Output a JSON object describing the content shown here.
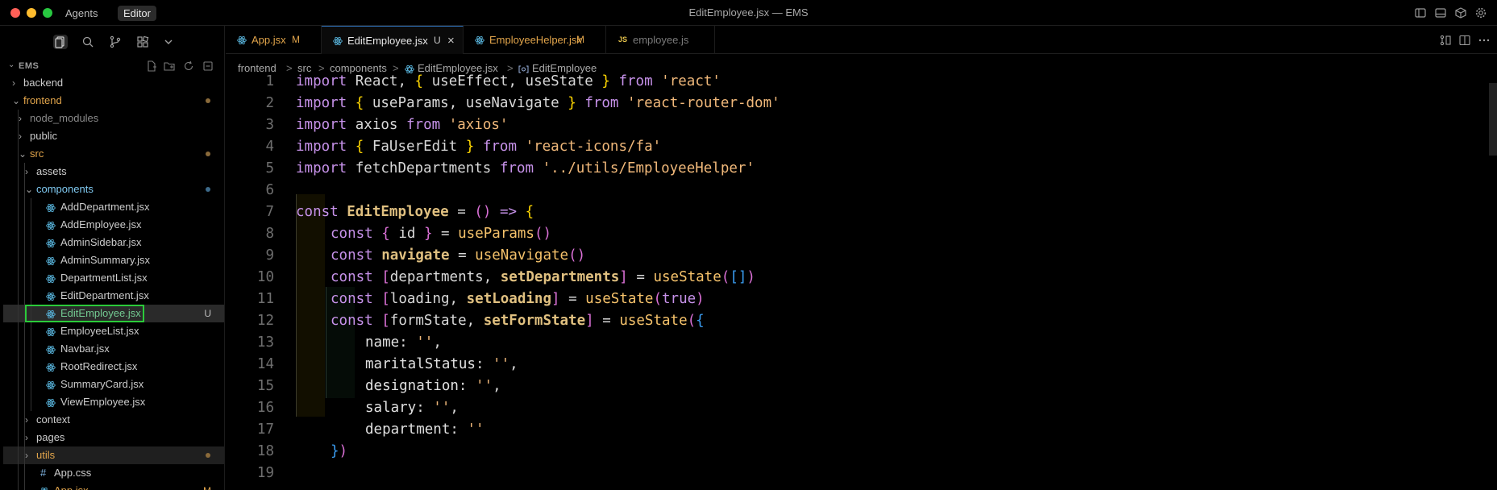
{
  "window": {
    "title": "EditEmployee.jsx — EMS",
    "modes": [
      "Agents",
      "Editor"
    ]
  },
  "explorer": {
    "root": "EMS",
    "tree": [
      {
        "label": "backend",
        "kind": "folder",
        "open": false,
        "depth": 0
      },
      {
        "label": "frontend",
        "kind": "folder",
        "open": true,
        "depth": 0,
        "dot": "#8a6a3a"
      },
      {
        "label": "node_modules",
        "kind": "folder",
        "open": false,
        "depth": 1,
        "dim": true
      },
      {
        "label": "public",
        "kind": "folder",
        "open": false,
        "depth": 1
      },
      {
        "label": "src",
        "kind": "folder",
        "open": true,
        "depth": 1,
        "dot": "#8a6a3a"
      },
      {
        "label": "assets",
        "kind": "folder",
        "open": false,
        "depth": 2
      },
      {
        "label": "components",
        "kind": "folder",
        "open": true,
        "depth": 2,
        "dot": "#3d6a8a"
      },
      {
        "label": "AddDepartment.jsx",
        "kind": "react",
        "depth": 3
      },
      {
        "label": "AddEmployee.jsx",
        "kind": "react",
        "depth": 3
      },
      {
        "label": "AdminSidebar.jsx",
        "kind": "react",
        "depth": 3
      },
      {
        "label": "AdminSummary.jsx",
        "kind": "react",
        "depth": 3
      },
      {
        "label": "DepartmentList.jsx",
        "kind": "react",
        "depth": 3
      },
      {
        "label": "EditDepartment.jsx",
        "kind": "react",
        "depth": 3
      },
      {
        "label": "EditEmployee.jsx",
        "kind": "react",
        "depth": 3,
        "selected": true,
        "status": "U"
      },
      {
        "label": "EmployeeList.jsx",
        "kind": "react",
        "depth": 3
      },
      {
        "label": "Navbar.jsx",
        "kind": "react",
        "depth": 3
      },
      {
        "label": "RootRedirect.jsx",
        "kind": "react",
        "depth": 3
      },
      {
        "label": "SummaryCard.jsx",
        "kind": "react",
        "depth": 3
      },
      {
        "label": "ViewEmployee.jsx",
        "kind": "react",
        "depth": 3
      },
      {
        "label": "context",
        "kind": "folder",
        "open": false,
        "depth": 2
      },
      {
        "label": "pages",
        "kind": "folder",
        "open": false,
        "depth": 2
      },
      {
        "label": "utils",
        "kind": "folder",
        "open": false,
        "depth": 2,
        "highlight": true,
        "dot": "#8a6a3a"
      },
      {
        "label": "App.css",
        "kind": "css",
        "depth": 2
      },
      {
        "label": "App.jsx",
        "kind": "react",
        "depth": 2,
        "status": "M",
        "partial": true
      }
    ]
  },
  "tabs": [
    {
      "label": "App.jsx",
      "status": "M",
      "icon": "react-icon"
    },
    {
      "label": "EditEmployee.jsx",
      "status": "U",
      "icon": "react-icon",
      "active": true,
      "close": "×"
    },
    {
      "label": "EmployeeHelper.jsx",
      "status": "M",
      "icon": "react-icon"
    },
    {
      "label": "employee.js",
      "status": "",
      "icon": "js-icon",
      "js": "JS"
    }
  ],
  "breadcrumb": [
    "frontend",
    "src",
    "components",
    "EditEmployee.jsx",
    "EditEmployee"
  ],
  "breadcrumb_sep": ">",
  "editor": {
    "line_numbers": [
      "1",
      "2",
      "3",
      "4",
      "5",
      "6",
      "7",
      "8",
      "9",
      "10",
      "11",
      "12",
      "13",
      "14",
      "15",
      "16",
      "17",
      "18",
      "19"
    ]
  },
  "colors": {
    "folder_modified": "#e2a54b",
    "untracked": "#73c991",
    "react_icon": "#58b4dc",
    "selection_outline": "#2bcb3a",
    "tab_active_accent": "#2f74c0"
  }
}
